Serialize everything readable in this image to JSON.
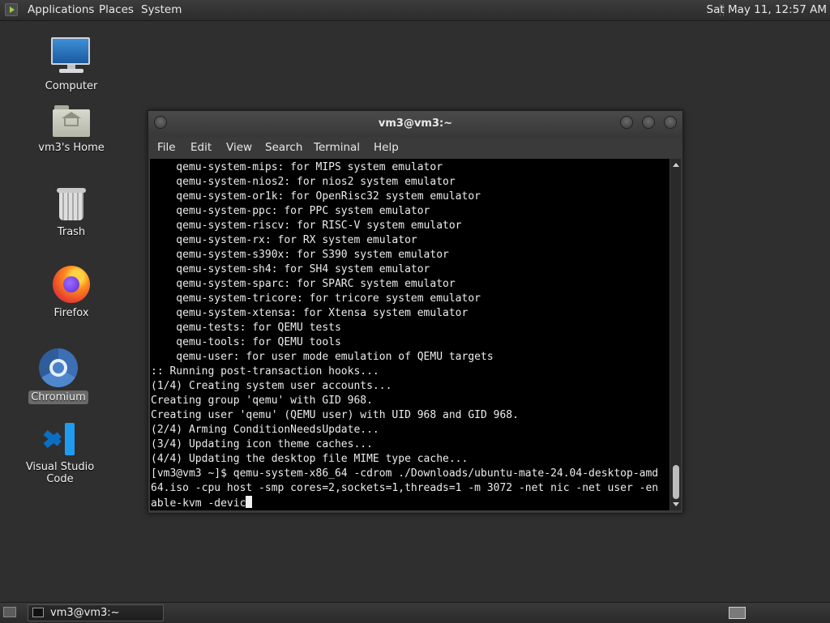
{
  "top_panel": {
    "menus": [
      "Applications",
      "Places",
      "System"
    ],
    "clock": "Sat May 11, 12:57 AM"
  },
  "desktop": {
    "icons": [
      {
        "label": "Computer",
        "icon": "computer-icon"
      },
      {
        "label": "vm3's Home",
        "icon": "home-folder-icon"
      },
      {
        "label": "Trash",
        "icon": "trash-icon"
      },
      {
        "label": "Firefox",
        "icon": "firefox-icon"
      },
      {
        "label": "Chromium",
        "icon": "chromium-icon",
        "selected": true
      },
      {
        "label": "Visual Studio Code",
        "icon": "vscode-icon"
      }
    ]
  },
  "terminal": {
    "title": "vm3@vm3:~",
    "menu": [
      "File",
      "Edit",
      "View",
      "Search",
      "Terminal",
      "Help"
    ],
    "lines": [
      "    qemu-system-mips: for MIPS system emulator",
      "    qemu-system-nios2: for nios2 system emulator",
      "    qemu-system-or1k: for OpenRisc32 system emulator",
      "    qemu-system-ppc: for PPC system emulator",
      "    qemu-system-riscv: for RISC-V system emulator",
      "    qemu-system-rx: for RX system emulator",
      "    qemu-system-s390x: for S390 system emulator",
      "    qemu-system-sh4: for SH4 system emulator",
      "    qemu-system-sparc: for SPARC system emulator",
      "    qemu-system-tricore: for tricore system emulator",
      "    qemu-system-xtensa: for Xtensa system emulator",
      "    qemu-tests: for QEMU tests",
      "    qemu-tools: for QEMU tools",
      "    qemu-user: for user mode emulation of QEMU targets",
      ":: Running post-transaction hooks...",
      "(1/4) Creating system user accounts...",
      "Creating group 'qemu' with GID 968.",
      "Creating user 'qemu' (QEMU user) with UID 968 and GID 968.",
      "(2/4) Arming ConditionNeedsUpdate...",
      "(3/4) Updating icon theme caches...",
      "(4/4) Updating the desktop file MIME type cache...",
      "[vm3@vm3 ~]$ qemu-system-x86_64 -cdrom ./Downloads/ubuntu-mate-24.04-desktop-amd",
      "64.iso -cpu host -smp cores=2,sockets=1,threads=1 -m 3072 -net nic -net user -en",
      "able-kvm -devic"
    ]
  },
  "taskbar": {
    "window_button": "vm3@vm3:~"
  }
}
